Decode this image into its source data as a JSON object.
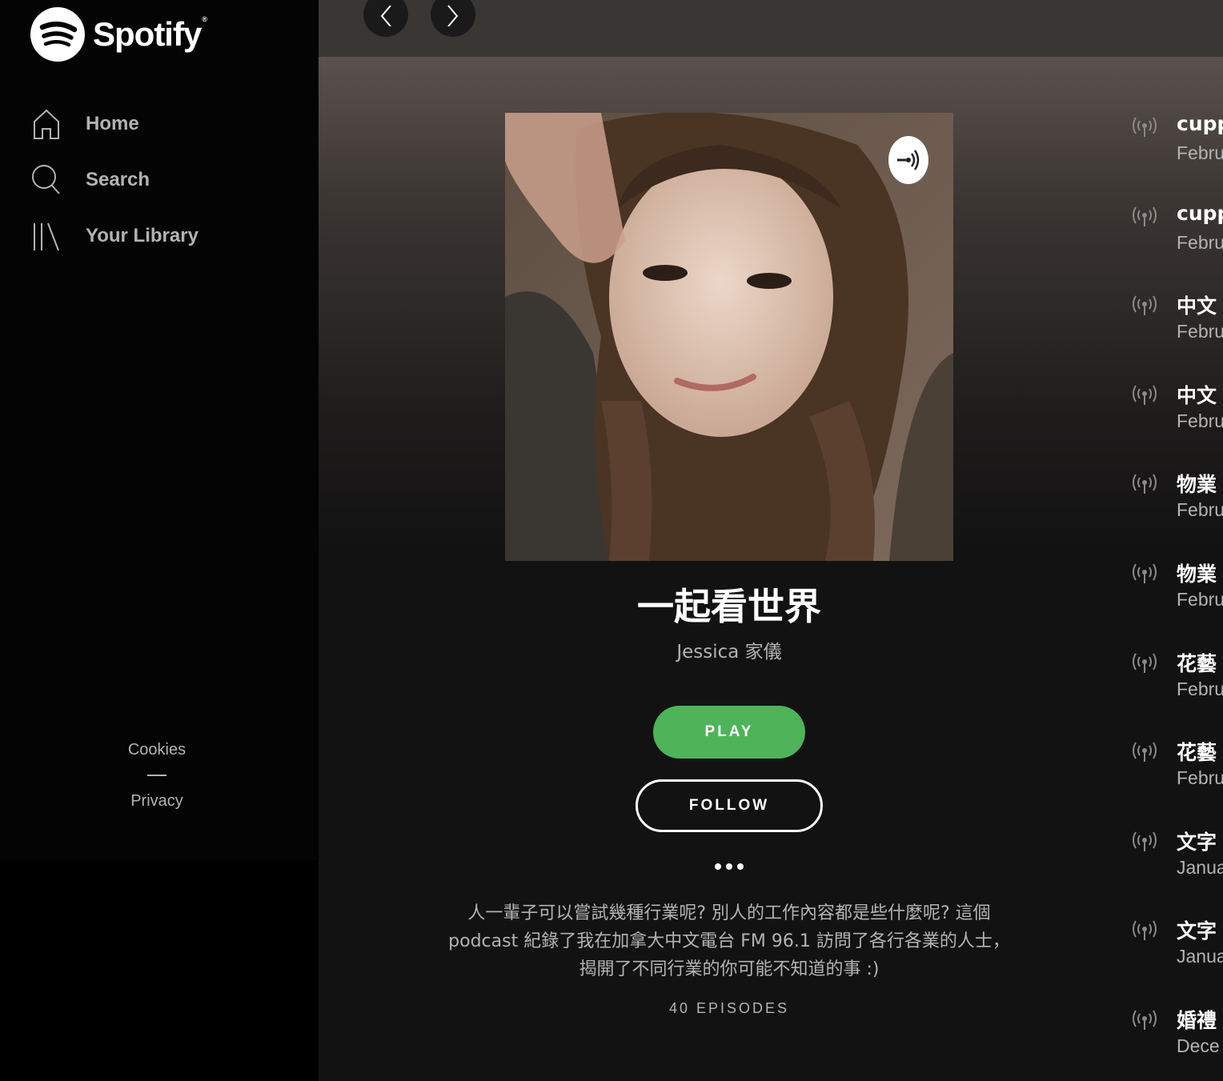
{
  "brand": {
    "name": "Spotify",
    "reg": "®"
  },
  "sidebar": {
    "items": [
      {
        "label": "Home",
        "icon": "home-icon"
      },
      {
        "label": "Search",
        "icon": "search-icon"
      },
      {
        "label": "Your Library",
        "icon": "library-icon"
      }
    ],
    "legal": {
      "cookies": "Cookies",
      "privacy": "Privacy"
    }
  },
  "podcast": {
    "title": "一起看世界",
    "author": "Jessica 家儀",
    "play_label": "PLAY",
    "follow_label": "FOLLOW",
    "description": "人一輩子可以嘗試幾種行業呢? 別人的工作內容都是些什麼呢? 這個 podcast 紀錄了我在加拿大中文電台 FM 96.1 訪問了各行各業的人士，  揭開了不同行業的你可能不知道的事 :)",
    "episode_count": "40 EPISODES"
  },
  "episodes": [
    {
      "title": "cupp",
      "date": "Febru"
    },
    {
      "title": "cupp",
      "date": "Febru"
    },
    {
      "title": "中文",
      "date": "Febru"
    },
    {
      "title": "中文",
      "date": "Febru"
    },
    {
      "title": "物業",
      "date": "Febru"
    },
    {
      "title": "物業",
      "date": "Febru"
    },
    {
      "title": "花藝",
      "date": "Febru"
    },
    {
      "title": "花藝",
      "date": "Febru"
    },
    {
      "title": "文字",
      "date": "Janua"
    },
    {
      "title": "文字",
      "date": "Janua"
    },
    {
      "title": "婚禮",
      "date": "Dece"
    }
  ],
  "colors": {
    "accent": "#4fb35a",
    "sidebar": "#040404",
    "main": "#121212",
    "muted": "#b3b3b3"
  }
}
